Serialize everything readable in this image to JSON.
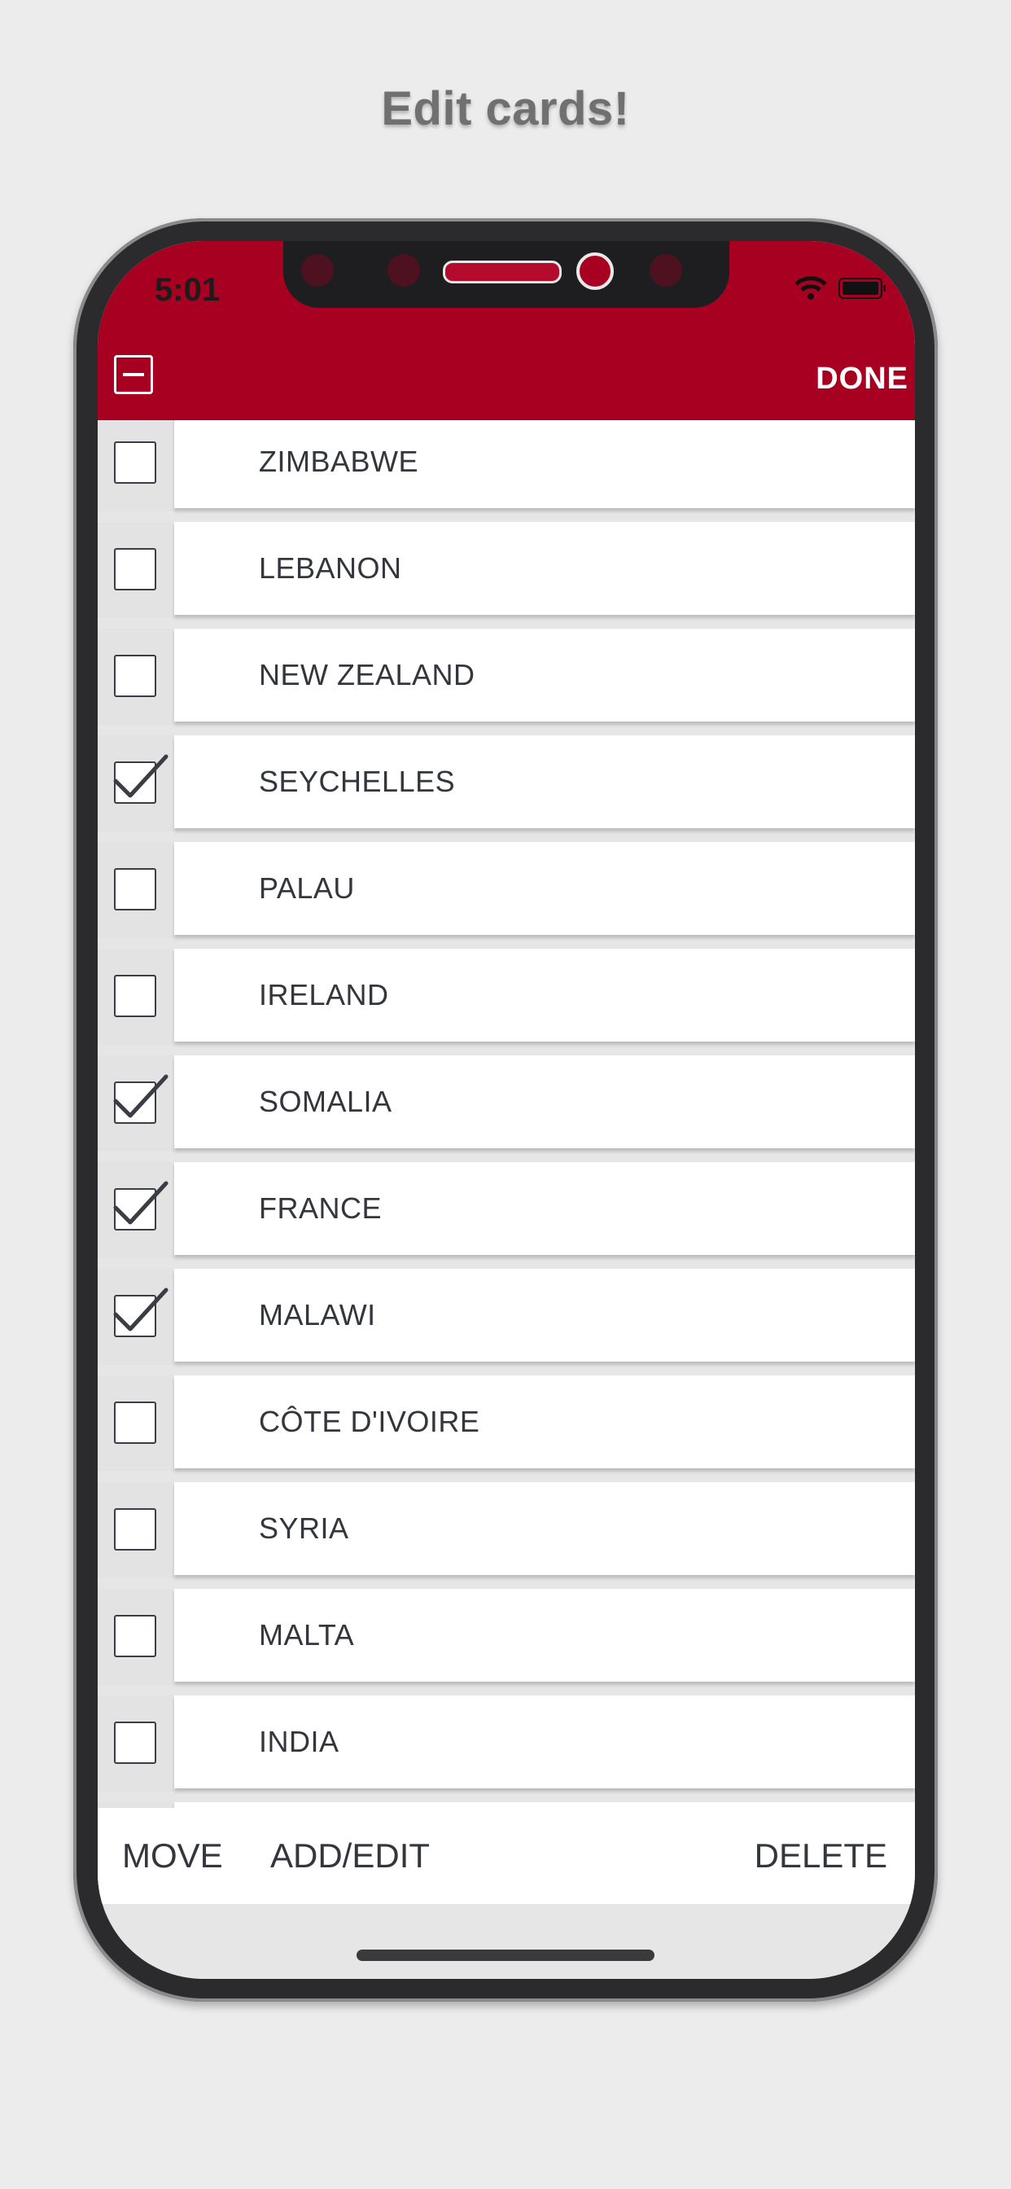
{
  "promo": {
    "title": "Edit cards!"
  },
  "status_bar": {
    "time": "5:01",
    "icons": [
      "wifi-icon",
      "battery-icon"
    ]
  },
  "header": {
    "deselect_icon": "minus-square-icon",
    "done_label": "DONE"
  },
  "colors": {
    "accent": "#a80021",
    "text": "#33363d",
    "background": "#ececec"
  },
  "cards": [
    {
      "label": "ZIMBABWE",
      "checked": false
    },
    {
      "label": "LEBANON",
      "checked": false
    },
    {
      "label": "NEW ZEALAND",
      "checked": false
    },
    {
      "label": "SEYCHELLES",
      "checked": true
    },
    {
      "label": "PALAU",
      "checked": false
    },
    {
      "label": "IRELAND",
      "checked": false
    },
    {
      "label": "SOMALIA",
      "checked": true
    },
    {
      "label": "FRANCE",
      "checked": true
    },
    {
      "label": "MALAWI",
      "checked": true
    },
    {
      "label": "CÔTE D'IVOIRE",
      "checked": false
    },
    {
      "label": "SYRIA",
      "checked": false
    },
    {
      "label": "MALTA",
      "checked": false
    },
    {
      "label": "INDIA",
      "checked": false
    }
  ],
  "toolbar": {
    "move_label": "MOVE",
    "add_edit_label": "ADD/EDIT",
    "delete_label": "DELETE"
  }
}
